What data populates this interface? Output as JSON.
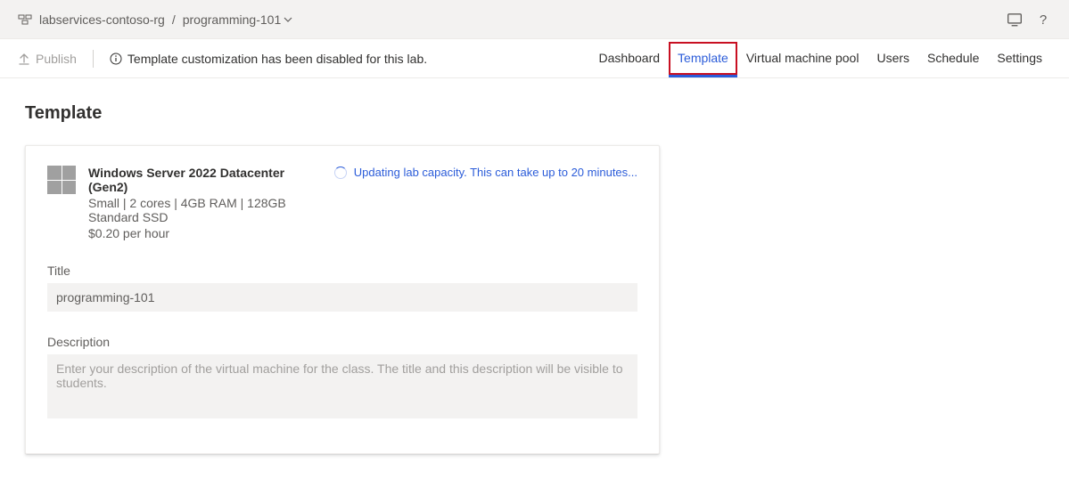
{
  "breadcrumb": {
    "resource_group": "labservices-contoso-rg",
    "separator": "/",
    "lab_name": "programming-101"
  },
  "commandbar": {
    "publish_label": "Publish",
    "status_message": "Template customization has been disabled for this lab."
  },
  "tabs": {
    "dashboard": "Dashboard",
    "template": "Template",
    "vm_pool": "Virtual machine pool",
    "users": "Users",
    "schedule": "Schedule",
    "settings": "Settings"
  },
  "page": {
    "title": "Template"
  },
  "template": {
    "os_name": "Windows Server 2022 Datacenter (Gen2)",
    "specs": "Small | 2 cores | 4GB RAM | 128GB Standard SSD",
    "price": "$0.20 per hour",
    "updating_status": "Updating lab capacity. This can take up to 20 minutes..."
  },
  "fields": {
    "title_label": "Title",
    "title_value": "programming-101",
    "description_label": "Description",
    "description_placeholder": "Enter your description of the virtual machine for the class. The title and this description will be visible to students."
  }
}
